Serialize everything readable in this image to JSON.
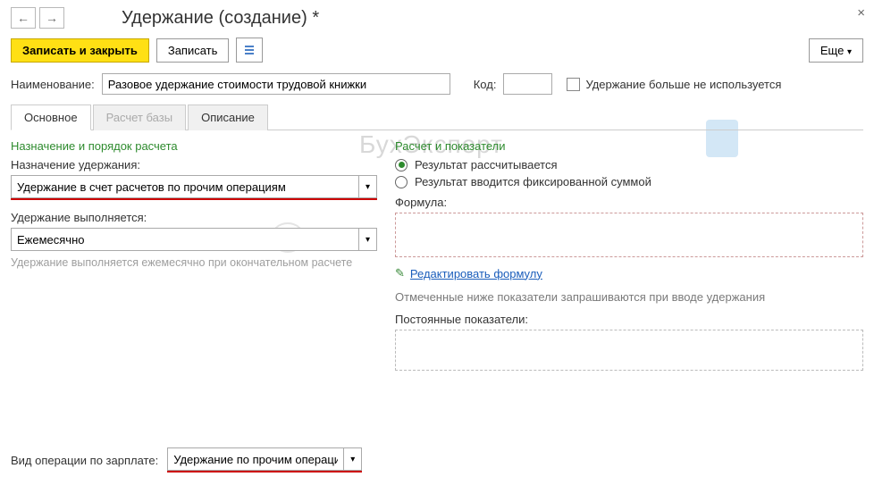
{
  "header": {
    "title": "Удержание (создание) *"
  },
  "toolbar": {
    "save_close": "Записать и закрыть",
    "save": "Записать",
    "more": "Еще"
  },
  "name_row": {
    "name_label": "Наименование:",
    "name_value": "Разовое удержание стоимости трудовой книжки",
    "code_label": "Код:",
    "code_value": "",
    "not_used_label": "Удержание больше не используется"
  },
  "tabs": {
    "main": "Основное",
    "base": "Расчет базы",
    "desc": "Описание"
  },
  "left": {
    "section": "Назначение и порядок расчета",
    "purpose_label": "Назначение удержания:",
    "purpose_value": "Удержание в счет расчетов по прочим операциям",
    "executed_label": "Удержание выполняется:",
    "executed_value": "Ежемесячно",
    "hint": "Удержание выполняется ежемесячно при окончательном расчете"
  },
  "right": {
    "section": "Расчет и показатели",
    "radio_calc": "Результат рассчитывается",
    "radio_fixed": "Результат вводится фиксированной суммой",
    "formula_label": "Формула:",
    "edit_formula": "Редактировать формулу",
    "desc": "Отмеченные ниже показатели запрашиваются при вводе удержания",
    "const_label": "Постоянные показатели:"
  },
  "bottom": {
    "label": "Вид операции по зарплате:",
    "value": "Удержание по прочим операциям"
  },
  "watermark": "БухЭксперт"
}
